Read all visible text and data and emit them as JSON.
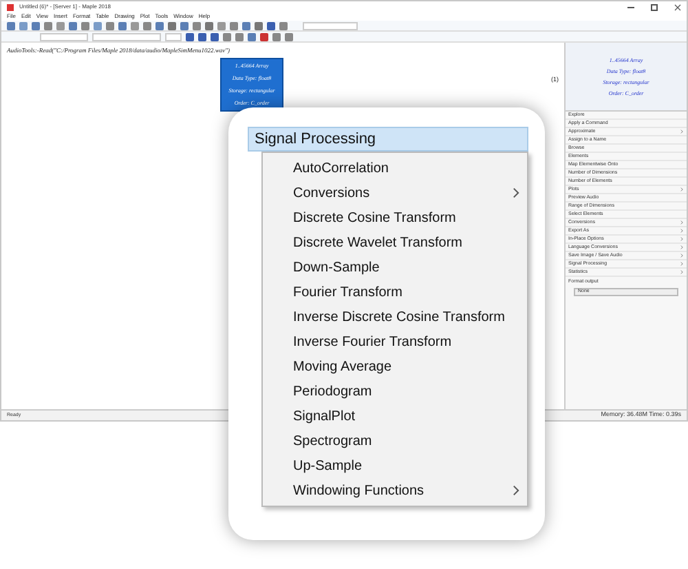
{
  "window": {
    "title": "Untitled (6)* - [Server 1] - Maple 2018"
  },
  "menu_bar": [
    "File",
    "Edit",
    "View",
    "Insert",
    "Format",
    "Table",
    "Drawing",
    "Plot",
    "Tools",
    "Window",
    "Help"
  ],
  "document": {
    "command": "AudioTools:-Read(\"C:/Program Files/Maple 2018/data/audio/MapleSimMenu1022.wav\")",
    "equation_label": "(1)",
    "tooltip": [
      "1..45664 Array",
      "Data Type: float8",
      "Storage: rectangular",
      "Order: C_order"
    ]
  },
  "context_panel": {
    "preview": [
      "1..45664 Array",
      "Data Type: float8",
      "Storage: rectangular",
      "Order: C_order"
    ],
    "items": [
      {
        "label": "Explore",
        "submenu": false
      },
      {
        "label": "Apply a Command",
        "submenu": false
      },
      {
        "label": "Approximate",
        "submenu": true
      },
      {
        "label": "Assign to a Name",
        "submenu": false
      },
      {
        "label": "Browse",
        "submenu": false
      },
      {
        "label": "Elements",
        "submenu": false
      },
      {
        "label": "Map Elementwise Onto",
        "submenu": false
      },
      {
        "label": "Number of Dimensions",
        "submenu": false
      },
      {
        "label": "Number of Elements",
        "submenu": false
      },
      {
        "label": "Plots",
        "submenu": true
      },
      {
        "label": "Preview Audio",
        "submenu": false
      },
      {
        "label": "Range of Dimensions",
        "submenu": false
      },
      {
        "label": "Select Elements",
        "submenu": false
      },
      {
        "label": "Conversions",
        "submenu": true
      },
      {
        "label": "Export As",
        "submenu": true
      },
      {
        "label": "In-Place Options",
        "submenu": true
      },
      {
        "label": "Language Conversions",
        "submenu": true
      },
      {
        "label": "Save Image / Save Audio",
        "submenu": true
      },
      {
        "label": "Signal Processing",
        "submenu": true
      },
      {
        "label": "Statistics",
        "submenu": true
      }
    ],
    "format_output": {
      "label": "Format output",
      "value": "None"
    }
  },
  "status_bar": {
    "left": "Ready",
    "right": "Memory: 36.48M  Time: 0.39s"
  },
  "magnifier": {
    "header": "Signal Processing",
    "items": [
      {
        "label": "AutoCorrelation",
        "submenu": false
      },
      {
        "label": "Conversions",
        "submenu": true
      },
      {
        "label": "Discrete Cosine Transform",
        "submenu": false
      },
      {
        "label": "Discrete Wavelet Transform",
        "submenu": false
      },
      {
        "label": "Down-Sample",
        "submenu": false
      },
      {
        "label": "Fourier Transform",
        "submenu": false
      },
      {
        "label": "Inverse Discrete Cosine Transform",
        "submenu": false
      },
      {
        "label": "Inverse Fourier Transform",
        "submenu": false
      },
      {
        "label": "Moving Average",
        "submenu": false
      },
      {
        "label": "Periodogram",
        "submenu": false
      },
      {
        "label": "SignalPlot",
        "submenu": false
      },
      {
        "label": "Spectrogram",
        "submenu": false
      },
      {
        "label": "Up-Sample",
        "submenu": false
      },
      {
        "label": "Windowing Functions",
        "submenu": true
      }
    ]
  }
}
